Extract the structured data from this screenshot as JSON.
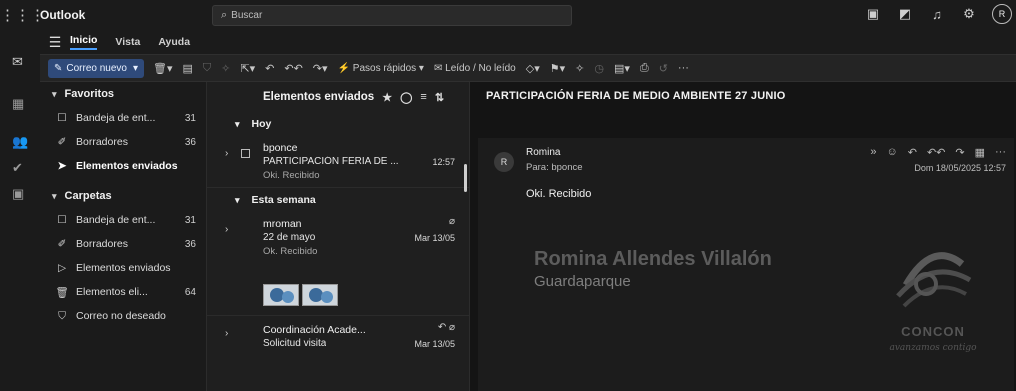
{
  "app": {
    "title": "Outlook"
  },
  "search": {
    "placeholder": "Buscar"
  },
  "topbar_icons": [
    "app-icon",
    "chat-icon",
    "bell-icon",
    "gear-icon"
  ],
  "user": {
    "initial": "R"
  },
  "menu": {
    "tabs": [
      "Inicio",
      "Vista",
      "Ayuda"
    ],
    "active": "Inicio"
  },
  "toolbar": {
    "new_mail": "Correo nuevo",
    "quick_steps": "Pasos rápidos",
    "read_unread": "Leído / No leído"
  },
  "folders": {
    "favorites_label": "Favoritos",
    "favorites": [
      {
        "label": "Bandeja de ent...",
        "count": "31"
      },
      {
        "label": "Borradores",
        "count": "36"
      },
      {
        "label": "Elementos enviados",
        "count": ""
      }
    ],
    "folders_label": "Carpetas",
    "items": [
      {
        "label": "Bandeja de ent...",
        "count": "31"
      },
      {
        "label": "Borradores",
        "count": "36"
      },
      {
        "label": "Elementos enviados",
        "count": ""
      },
      {
        "label": "Elementos eli...",
        "count": "64"
      },
      {
        "label": "Correo no deseado",
        "count": ""
      }
    ]
  },
  "list": {
    "title": "Elementos enviados",
    "groups": [
      "Hoy",
      "Esta semana"
    ],
    "messages": [
      {
        "sender": "bponce",
        "subject": "PARTICIPACIÓN FERIA DE ...",
        "date": "12:57",
        "preview": "Oki. Recibido"
      },
      {
        "sender": "mroman",
        "subject": "22 de mayo",
        "date": "Mar 13/05",
        "preview": "Ok. Recibido"
      },
      {
        "sender": "Coordinación Acade...",
        "subject": "Solicitud visita",
        "date": "Mar 13/05",
        "preview": ""
      }
    ]
  },
  "reading": {
    "subject": "PARTICIPACIÓN FERIA DE MEDIO AMBIENTE 27 JUNIO",
    "avatar": "R",
    "from": "Romina",
    "to": "Para: bponce",
    "date": "Dom 18/05/2025 12:57",
    "body": "Oki. Recibido",
    "signature_name": "Romina Allendes Villalón",
    "signature_role": "Guardaparque",
    "logo_text": "CONCON",
    "logo_tagline": "avanzamos contigo"
  }
}
